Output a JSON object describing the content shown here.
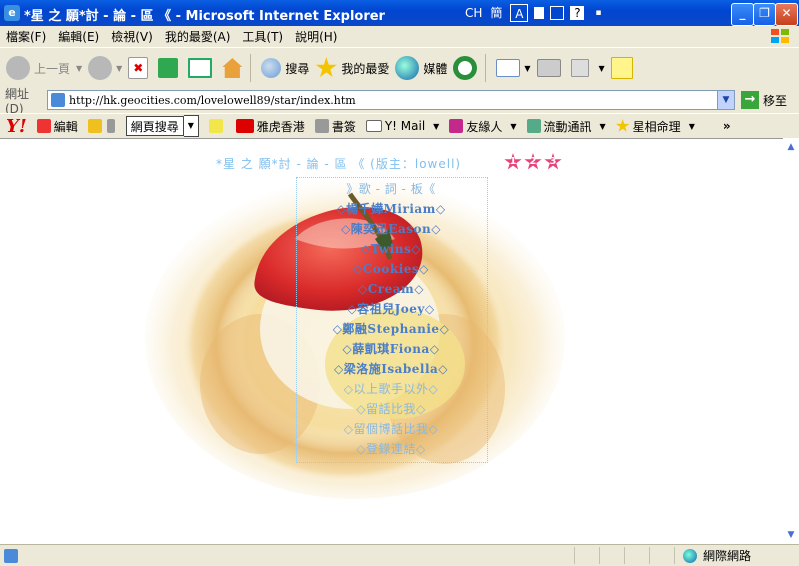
{
  "window": {
    "title": "*星 之 願*討 - 論 - 區 《 - Microsoft Internet Explorer",
    "ime_items": [
      "CH",
      "簡",
      "A",
      "",
      "",
      "?",
      ""
    ]
  },
  "menu": [
    "檔案(F)",
    "編輯(E)",
    "檢視(V)",
    "我的最愛(A)",
    "工具(T)",
    "說明(H)"
  ],
  "toolbar": {
    "back_label": "上一頁",
    "search_label": "搜尋",
    "favorites_label": "我的最愛",
    "media_label": "媒體"
  },
  "address": {
    "label": "網址(D)",
    "url": "http://hk.geocities.com/lovelowell89/star/index.htm",
    "go_label": "移至"
  },
  "yahoo": {
    "logo": "Y!",
    "edit_label": "編輯",
    "search_label": "網頁搜尋",
    "items": [
      "雅虎香港",
      "書簽",
      "Y! Mail",
      "友緣人",
      "流動通訊",
      "星相命理"
    ],
    "more": "»"
  },
  "page": {
    "heading": "*星 之 願*討 - 論 - 區 《 (版主：lowell)",
    "stars": [
      "1",
      "2",
      "3"
    ],
    "nav": [
      {
        "text": "》歌 - 詞 - 板《",
        "style": "light"
      },
      {
        "text": "◇楊千嬅Miriam◇",
        "style": "bold"
      },
      {
        "text": "◇陳奕迅Eason◇",
        "style": "bold"
      },
      {
        "text": "◇Twins◇",
        "style": "bold"
      },
      {
        "text": "◇Cookies◇",
        "style": "bold"
      },
      {
        "text": "◇Cream◇",
        "style": "bold"
      },
      {
        "text": "◇容祖兒Joey◇",
        "style": "bold"
      },
      {
        "text": "◇鄭融Stephanie◇",
        "style": "bold"
      },
      {
        "text": "◇薛凱琪Fiona◇",
        "style": "bold"
      },
      {
        "text": "◇梁洛施Isabella◇",
        "style": "bold"
      },
      {
        "text": "◇以上歌手以外◇",
        "style": "light"
      },
      {
        "text": "◇留話比我◇",
        "style": "light"
      },
      {
        "text": "◇留個博話比我◇",
        "style": "light"
      },
      {
        "text": "◇登錄連結◇",
        "style": "light"
      }
    ]
  },
  "status": {
    "zone": "網際網路"
  }
}
